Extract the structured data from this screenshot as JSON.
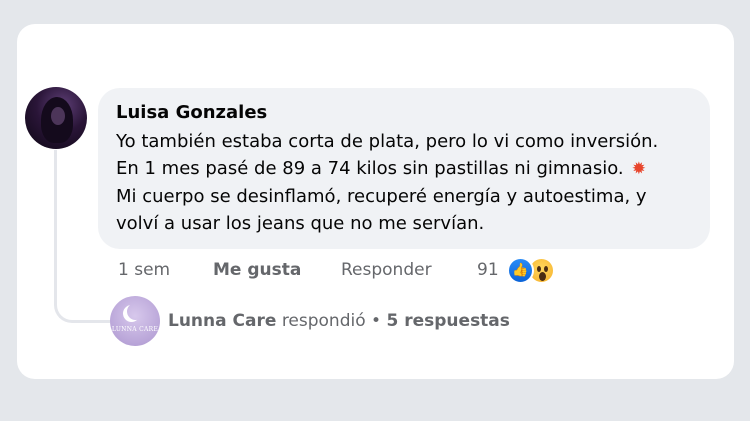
{
  "comment": {
    "author": "Luisa Gonzales",
    "text_before_icon": "Yo también estaba corta de plata, pero lo vi como inversión. En 1 mes pasé de 89 a 74 kilos sin pastillas ni gimnasio. ",
    "icon": "collision-emoji",
    "text_after_icon": " Mi cuerpo se desinflamó, recuperé energía y autoestima, y volví a usar los jeans que no me servían."
  },
  "actions": {
    "time": "1 sem",
    "like_label": "Me gusta",
    "reply_label": "Responder",
    "reaction_count": "91",
    "reactions": [
      "like-reaction-icon",
      "wow-reaction-icon"
    ]
  },
  "reply_summary": {
    "page_name": "Lunna Care",
    "verb": "respondió",
    "separator": "•",
    "replies": "5 respuestas",
    "avatar_text": "LUNNA CARE"
  },
  "colors": {
    "background": "#e4e7eb",
    "card": "#ffffff",
    "bubble": "#f0f2f5",
    "text": "#050505",
    "muted": "#65676b",
    "like_blue": "#1877f2",
    "wow_yellow": "#f7b12b"
  }
}
